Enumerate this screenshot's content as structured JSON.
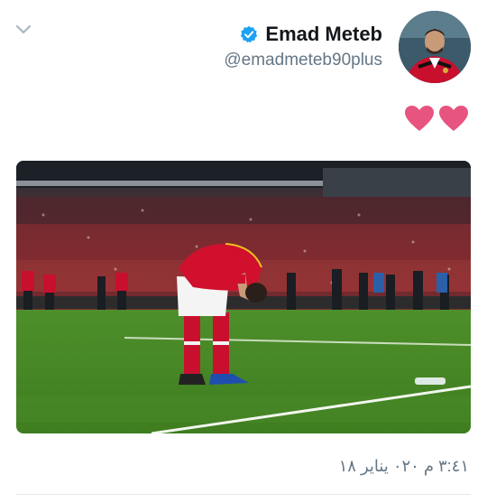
{
  "tweet": {
    "author": {
      "display_name": "Emad Meteb",
      "handle": "@emadmeteb90plus",
      "verified": true,
      "avatar_icon": "player-avatar"
    },
    "text_icons": [
      "heart-icon",
      "heart-icon"
    ],
    "media_alt": "",
    "timestamp": "٣:٤١ م ٠٢٠ يناير ١٨"
  },
  "colors": {
    "verified_blue": "#1da1f2",
    "heart_pink": "#e75480",
    "text_primary": "#14171a",
    "text_secondary": "#657786",
    "divider": "#e1e8ed"
  },
  "icons": {
    "menu": "chevron-down-icon",
    "verified": "verified-badge-icon"
  }
}
